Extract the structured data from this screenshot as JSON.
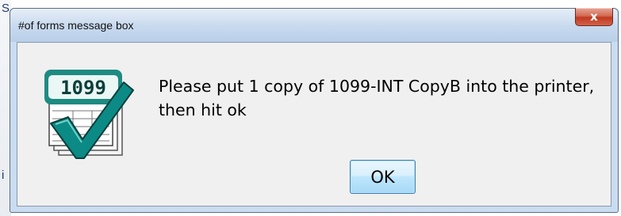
{
  "window": {
    "title": "#of forms message box",
    "close_glyph": "x"
  },
  "dialog": {
    "icon": "1099-form-checkmark-icon",
    "icon_label": "1099",
    "message": "Please put 1 copy of 1099-INT CopyB into the printer, then hit ok",
    "ok_label": "OK"
  },
  "background_strip": {
    "letters": [
      "S",
      "i"
    ]
  },
  "colors": {
    "titlebar": "#c7d9ee",
    "client": "#f0f0f0",
    "close_button": "#c0391f",
    "ok_button": "#bee6fd",
    "icon_teal": "#2a9d8f",
    "checkmark": "#0c8a86"
  }
}
